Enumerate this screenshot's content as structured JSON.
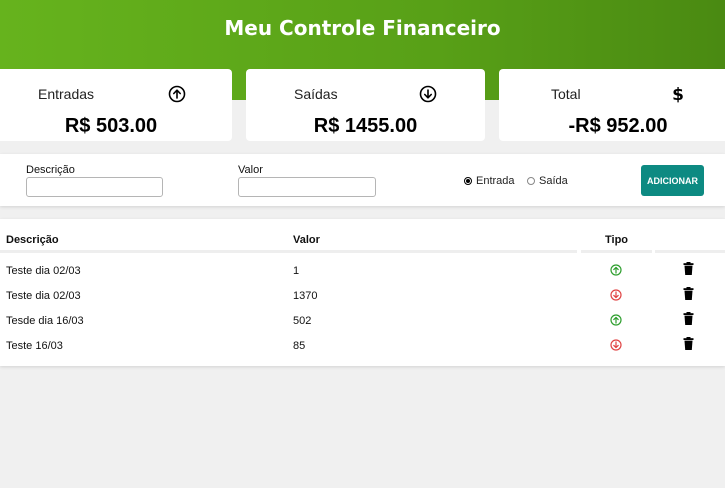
{
  "header": {
    "title": "Meu Controle Financeiro"
  },
  "summary": {
    "income": {
      "label": "Entradas",
      "amount": "R$ 503.00",
      "icon": "arrow-up-circle-icon"
    },
    "expense": {
      "label": "Saídas",
      "amount": "R$ 1455.00",
      "icon": "arrow-down-circle-icon"
    },
    "total": {
      "label": "Total",
      "amount": "-R$ 952.00",
      "icon": "dollar-icon"
    }
  },
  "form": {
    "description_label": "Descrição",
    "description_value": "",
    "value_label": "Valor",
    "value_value": "",
    "type_options": [
      {
        "label": "Entrada",
        "selected": true
      },
      {
        "label": "Saída",
        "selected": false
      }
    ],
    "add_button": "ADICIONAR"
  },
  "table": {
    "columns": [
      "Descrição",
      "Valor",
      "Tipo"
    ],
    "rows": [
      {
        "description": "Teste dia 02/03",
        "value": "1",
        "type": "entrada"
      },
      {
        "description": "Teste dia 02/03",
        "value": "1370",
        "type": "saida"
      },
      {
        "description": "Tesde dia 16/03",
        "value": "502",
        "type": "entrada"
      },
      {
        "description": "Teste 16/03",
        "value": "85",
        "type": "saida"
      }
    ]
  },
  "colors": {
    "header_start": "#66b31d",
    "header_end": "#4a8a12",
    "button": "#0d8a82",
    "income_icon": "#2e9e2e",
    "expense_icon": "#e04444"
  }
}
